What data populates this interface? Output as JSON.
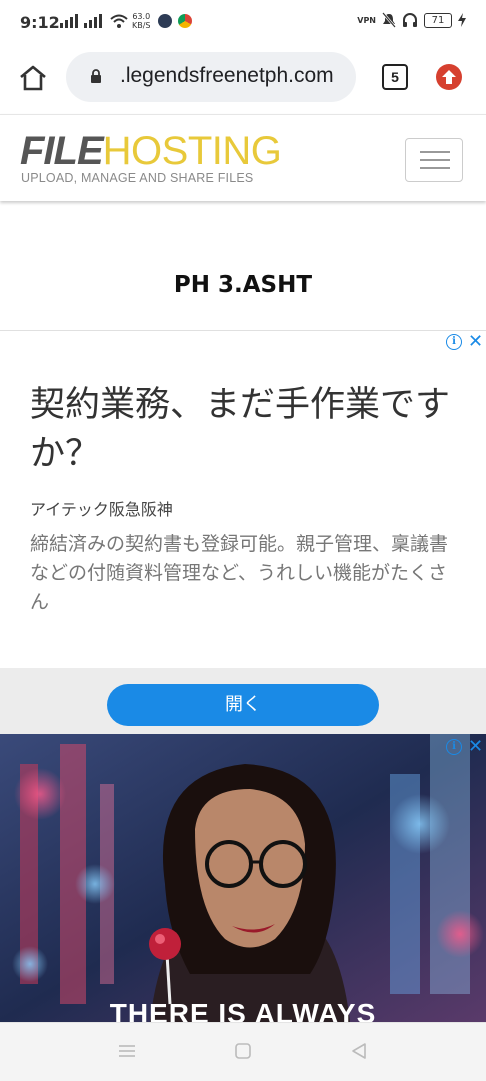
{
  "status_bar": {
    "time": "9:12",
    "net_speed_value": "63.0",
    "net_speed_unit": "KB/S",
    "vpn_label": "VPN",
    "battery": "71"
  },
  "browser": {
    "url": ".legendsfreenetph.com",
    "tab_count": "5"
  },
  "site_header": {
    "logo_part1": "FILE",
    "logo_part2": "HOSTING",
    "tagline": "UPLOAD, MANAGE AND SHARE FILES"
  },
  "page": {
    "title": "PH 3.ASHT"
  },
  "ad1": {
    "headline": "契約業務、まだ手作業ですか？",
    "advertiser": "アイテック阪急阪神",
    "description": "締結済みの契約書も登録可能。親子管理、稟議書などの付随資料管理など、うれしい機能がたくさん",
    "cta": "開く"
  },
  "ad2": {
    "caption": "THERE IS ALWAYS"
  },
  "colors": {
    "accent_blue": "#1a8ae6",
    "logo_gold": "#e8c93a",
    "logo_gray": "#565656"
  }
}
